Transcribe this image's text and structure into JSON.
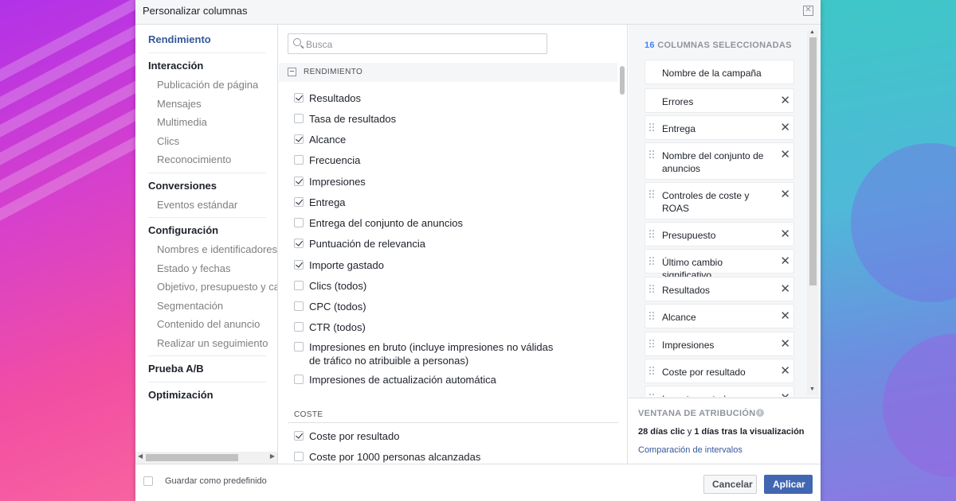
{
  "dialog": {
    "title": "Personalizar columnas"
  },
  "nav": {
    "sections": [
      {
        "head": "Rendimiento",
        "items": []
      },
      {
        "head": "Interacción",
        "items": [
          "Publicación de página",
          "Mensajes",
          "Multimedia",
          "Clics",
          "Reconocimiento"
        ]
      },
      {
        "head": "Conversiones",
        "items": [
          "Eventos estándar"
        ]
      },
      {
        "head": "Configuración",
        "items": [
          "Nombres e identificadores d",
          "Estado y fechas",
          "Objetivo, presupuesto y cal",
          "Segmentación",
          "Contenido del anuncio",
          "Realizar un seguimiento"
        ]
      },
      {
        "head": "Prueba A/B",
        "items": []
      },
      {
        "head": "Optimización",
        "items": []
      }
    ]
  },
  "search": {
    "placeholder": "Busca",
    "value": ""
  },
  "middle": {
    "section_title": "RENDIMIENTO",
    "options": [
      {
        "label": "Resultados",
        "checked": true
      },
      {
        "label": "Tasa de resultados",
        "checked": false
      },
      {
        "label": "Alcance",
        "checked": true
      },
      {
        "label": "Frecuencia",
        "checked": false
      },
      {
        "label": "Impresiones",
        "checked": true
      },
      {
        "label": "Entrega",
        "checked": true
      },
      {
        "label": "Entrega del conjunto de anuncios",
        "checked": false
      },
      {
        "label": "Puntuación de relevancia",
        "checked": true
      },
      {
        "label": "Importe gastado",
        "checked": true
      },
      {
        "label": "Clics (todos)",
        "checked": false
      },
      {
        "label": "CPC (todos)",
        "checked": false
      },
      {
        "label": "CTR (todos)",
        "checked": false
      },
      {
        "label": "Impresiones en bruto (incluye impresiones no válidas de tráfico no atribuible a personas)",
        "checked": false
      },
      {
        "label": "Impresiones de actualización automática",
        "checked": false
      }
    ],
    "section2_title": "COSTE",
    "options2": [
      {
        "label": "Coste por resultado",
        "checked": true
      },
      {
        "label": "Coste por 1000 personas alcanzadas",
        "checked": false
      }
    ]
  },
  "selected": {
    "count": "16",
    "heading": "COLUMNAS SELECCIONADAS",
    "items": [
      "Nombre de la campaña",
      "Errores",
      "Entrega",
      "Nombre del conjunto de anuncios",
      "Controles de coste y ROAS",
      "Presupuesto",
      "Último cambio significativo",
      "Resultados",
      "Alcance",
      "Impresiones",
      "Coste por resultado",
      "Importe gastado"
    ]
  },
  "attribution": {
    "title": "VENTANA DE ATRIBUCIÓN",
    "click_days": "28 días clic",
    "connector": " y ",
    "view_days": "1 días tras la visualización",
    "link": "Comparación de intervalos"
  },
  "footer": {
    "save_default_label": "Guardar como predefinido",
    "cancel_label": "Cancelar",
    "apply_label": "Aplicar"
  },
  "colors": {
    "accent": "#4267b2",
    "link": "#365899",
    "count": "#4080ff"
  }
}
